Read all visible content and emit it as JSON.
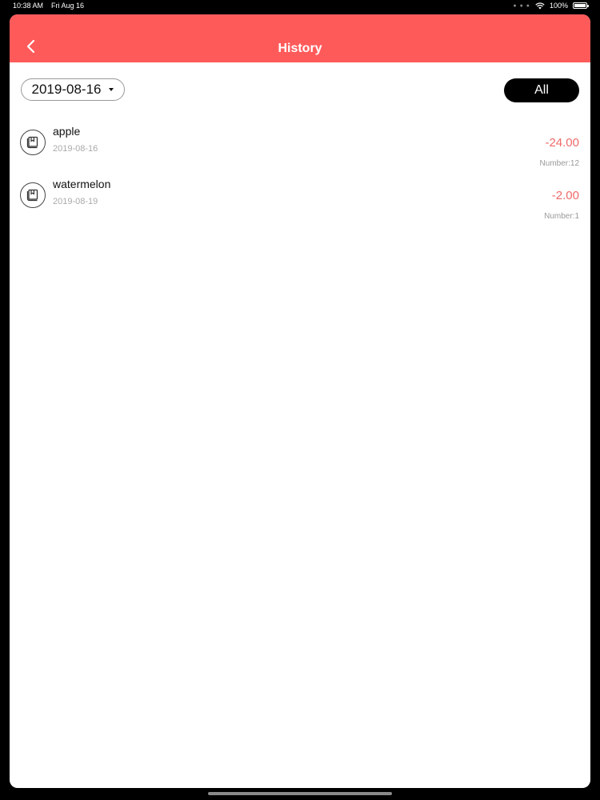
{
  "status_bar": {
    "time": "10:38 AM",
    "date": "Fri Aug 16",
    "battery": "100%"
  },
  "nav": {
    "title": "History",
    "back_icon": "chevron-left-icon"
  },
  "filter": {
    "date_value": "2019-08-16",
    "all_label": "All"
  },
  "items": [
    {
      "name": "apple",
      "date": "2019-08-16",
      "amount": "-24.00",
      "number": "Number:12",
      "icon": "product-icon"
    },
    {
      "name": "watermelon",
      "date": "2019-08-19",
      "amount": "-2.00",
      "number": "Number:1",
      "icon": "product-icon"
    }
  ],
  "colors": {
    "header": "#ff5a5a",
    "amount": "#f06a6a",
    "secondary_text": "#aaaaaa"
  }
}
